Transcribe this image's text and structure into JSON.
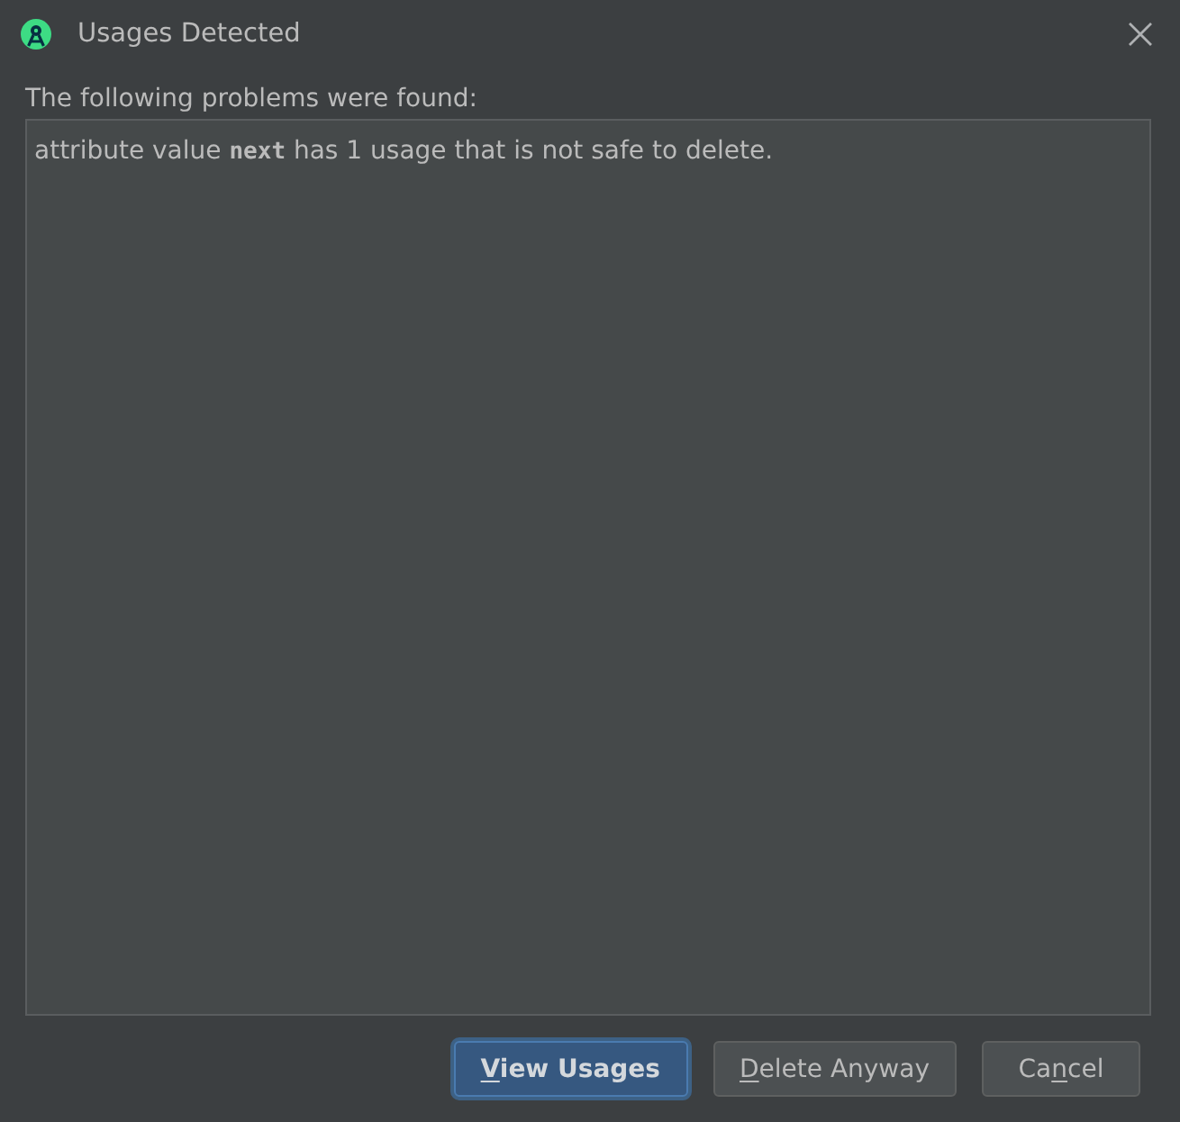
{
  "window": {
    "title": "Usages Detected"
  },
  "prompt": "The following problems were found:",
  "problems": [
    "attribute value **next** has 1 usage that is not safe to delete."
  ],
  "buttons": [
    {
      "mnemonic": "V",
      "after": "iew Usages",
      "default": true
    },
    {
      "mnemonic": "D",
      "after": "elete Anyway",
      "default": false
    },
    {
      "before": "Ca",
      "mnemonic": "n",
      "after": "cel",
      "default": false
    }
  ]
}
